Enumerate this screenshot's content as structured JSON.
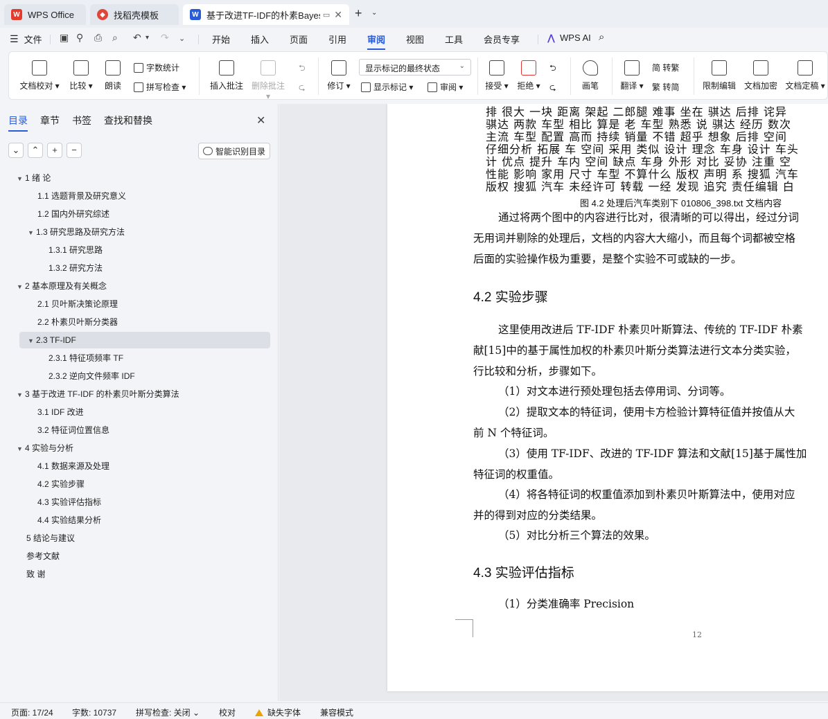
{
  "tabs": {
    "home": "WPS Office",
    "template": "找稻壳模板",
    "document": "基于改进TF-IDF的朴素Bayes"
  },
  "menu": {
    "file": "文件",
    "items": [
      "开始",
      "插入",
      "页面",
      "引用",
      "审阅",
      "视图",
      "工具",
      "会员专享"
    ],
    "active": "审阅",
    "wps_ai": "WPS AI"
  },
  "ribbon": {
    "doc_check": "文档校对",
    "compare": "比较",
    "read_aloud": "朗读",
    "word_count": "字数统计",
    "spell_check": "拼写检查",
    "insert_comment": "插入批注",
    "delete_comment": "删除批注",
    "revise": "修订",
    "markup_state": "显示标记的最终状态",
    "show_markup": "显示标记",
    "review": "审阅",
    "accept": "接受",
    "reject": "拒绝",
    "pen": "画笔",
    "translate": "翻译",
    "to_traditional": "简 转繁",
    "to_simplified": "繁 转简",
    "restrict_edit": "限制编辑",
    "doc_encrypt": "文档加密",
    "doc_finalize": "文档定稿"
  },
  "sidebar": {
    "tabs": [
      "目录",
      "章节",
      "书签",
      "查找和替换"
    ],
    "active_tab": "目录",
    "smart_toc": "智能识别目录",
    "toc": [
      {
        "label": "1  绪  论",
        "level": 1,
        "expanded": true
      },
      {
        "label": "1.1  选题背景及研究意义",
        "level": 2
      },
      {
        "label": "1.2  国内外研究综述",
        "level": 2
      },
      {
        "label": "1.3  研究思路及研究方法",
        "level": 2,
        "expanded": true
      },
      {
        "label": "1.3.1  研究思路",
        "level": 3
      },
      {
        "label": "1.3.2  研究方法",
        "level": 3
      },
      {
        "label": "2  基本原理及有关概念",
        "level": 1,
        "expanded": true
      },
      {
        "label": "2.1  贝叶斯决策论原理",
        "level": 2
      },
      {
        "label": "2.2  朴素贝叶斯分类器",
        "level": 2
      },
      {
        "label": "2.3 TF-IDF",
        "level": 2,
        "expanded": true,
        "selected": true
      },
      {
        "label": "2.3.1  特征项频率 TF",
        "level": 3
      },
      {
        "label": "2.3.2  逆向文件频率 IDF",
        "level": 3
      },
      {
        "label": "3  基于改进 TF-IDF 的朴素贝叶斯分类算法",
        "level": 1,
        "expanded": true
      },
      {
        "label": "3.1 IDF 改进",
        "level": 2
      },
      {
        "label": "3.2  特征词位置信息",
        "level": 2
      },
      {
        "label": "4  实验与分析",
        "level": 1,
        "expanded": true
      },
      {
        "label": "4.1  数据来源及处理",
        "level": 2
      },
      {
        "label": "4.2  实验步骤",
        "level": 2
      },
      {
        "label": "4.3  实验评估指标",
        "level": 2
      },
      {
        "label": "4.4  实验结果分析",
        "level": 2
      },
      {
        "label": "5  结论与建议",
        "level": 1
      },
      {
        "label": "参考文献",
        "level": 1
      },
      {
        "label": "致  谢",
        "level": 1
      }
    ]
  },
  "document": {
    "word_lines": [
      "排 很大 一块 距离 架起 二郎腿 难事 坐在 骐达 后排 诧异",
      "骐达 两款 车型 相比 算是 老 车型 熟悉 说 骐达 经历 数次",
      "主流 车型 配置 高而 持续 销量 不错 超乎 想象 后排 空间",
      "仔细分析 拓展 车 空间 采用 类似 设计 理念 车身 设计 车头",
      "计 优点 提升 车内 空间 缺点 车身 外形 对比 妥协 注重 空",
      "性能 影响 家用 尺寸 车型 不算什么 版权 声明 系 搜狐 汽车",
      "版权 搜狐 汽车 未经许可 转载 一经 发现 追究 责任编辑 白"
    ],
    "caption": "图 4.2  处理后汽车类别下 010806_398.txt 文档内容",
    "para1": [
      "通过将两个图中的内容进行比对，很清晰的可以得出，经过分词",
      "无用词并剔除的处理后，文档的内容大大缩小，而且每个词都被空格",
      "后面的实验操作极为重要，是整个实验不可或缺的一步。"
    ],
    "heading1": "4.2  实验步骤",
    "para2": [
      "这里使用改进后 TF-IDF 朴素贝叶斯算法、传统的 TF-IDF 朴素",
      "献[15]中的基于属性加权的朴素贝叶斯分类算法进行文本分类实验，",
      "行比较和分析，步骤如下。",
      "（1）对文本进行预处理包括去停用词、分词等。",
      "（2）提取文本的特征词，使用卡方检验计算特征值并按值从大",
      "前 N 个特征词。",
      "（3）使用 TF-IDF、改进的 TF-IDF 算法和文献[15]基于属性加",
      "特征词的权重值。",
      "（4）将各特征词的权重值添加到朴素贝叶斯算法中，使用对应",
      "并的得到对应的分类结果。",
      "（5）对比分析三个算法的效果。"
    ],
    "heading2": "4.3  实验评估指标",
    "para3": "（1）分类准确率  Precision",
    "page_number": "12"
  },
  "status": {
    "page": "页面: 17/24",
    "words": "字数: 10737",
    "spell": "拼写检查: 关闭",
    "proof": "校对",
    "missing_font": "缺失字体",
    "compat": "兼容模式"
  }
}
